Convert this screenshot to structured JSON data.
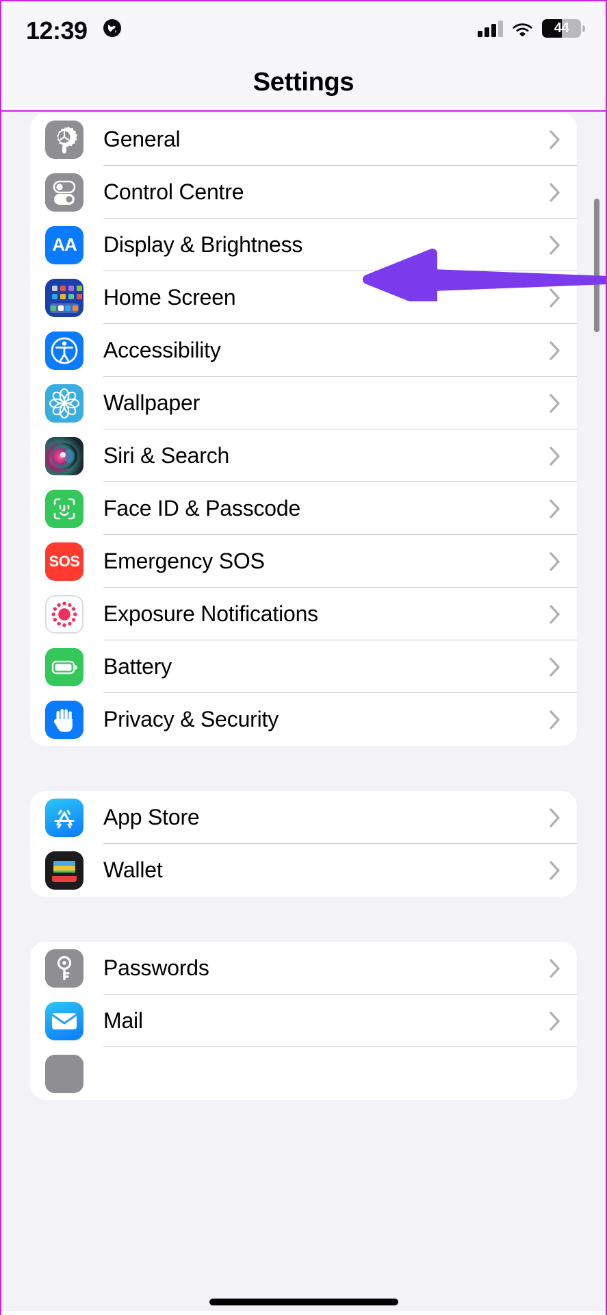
{
  "status_bar": {
    "time": "12:39",
    "location_icon": "globe-icon",
    "signal_icon": "cellular-signal-icon",
    "signal_bars_filled": 3,
    "signal_bars_total": 4,
    "wifi_icon": "wifi-icon",
    "battery_percent": "44",
    "battery_level": 44
  },
  "navbar": {
    "title": "Settings"
  },
  "groups": [
    {
      "id": "system-group",
      "rows": [
        {
          "label": "General",
          "icon": "gear-icon",
          "icon_class": "ic-gear",
          "art": "gear"
        },
        {
          "label": "Control Centre",
          "icon": "control-centre-icon",
          "icon_class": "ic-cc",
          "art": "toggles"
        },
        {
          "label": "Display & Brightness",
          "icon": "display-brightness-icon",
          "icon_class": "ic-disp",
          "art": "aa"
        },
        {
          "label": "Home Screen",
          "icon": "home-screen-icon",
          "icon_class": "ic-home",
          "art": "homegrid"
        },
        {
          "label": "Accessibility",
          "icon": "accessibility-icon",
          "icon_class": "ic-acc",
          "art": "accessibility"
        },
        {
          "label": "Wallpaper",
          "icon": "wallpaper-icon",
          "icon_class": "ic-wall",
          "art": "flower"
        },
        {
          "label": "Siri & Search",
          "icon": "siri-icon",
          "icon_class": "ic-siri",
          "art": "siri"
        },
        {
          "label": "Face ID & Passcode",
          "icon": "face-id-icon",
          "icon_class": "ic-face",
          "art": "faceid"
        },
        {
          "label": "Emergency SOS",
          "icon": "emergency-sos-icon",
          "icon_class": "ic-sos",
          "art": "sos"
        },
        {
          "label": "Exposure Notifications",
          "icon": "exposure-notifications-icon",
          "icon_class": "ic-exp",
          "art": "exposure"
        },
        {
          "label": "Battery",
          "icon": "battery-icon",
          "icon_class": "ic-batt",
          "art": "battery"
        },
        {
          "label": "Privacy & Security",
          "icon": "privacy-security-icon",
          "icon_class": "ic-priv",
          "art": "hand"
        }
      ]
    },
    {
      "id": "store-group",
      "rows": [
        {
          "label": "App Store",
          "icon": "app-store-icon",
          "icon_class": "ic-apps",
          "art": "appstore"
        },
        {
          "label": "Wallet",
          "icon": "wallet-icon",
          "icon_class": "ic-wallet",
          "art": "wallet"
        }
      ]
    },
    {
      "id": "accounts-group",
      "rows": [
        {
          "label": "Passwords",
          "icon": "passwords-key-icon",
          "icon_class": "ic-pass",
          "art": "key"
        },
        {
          "label": "Mail",
          "icon": "mail-icon",
          "icon_class": "ic-mail",
          "art": "envelope"
        },
        {
          "label": "",
          "icon": "contacts-icon",
          "icon_class": "ic-gray",
          "art": "blank"
        }
      ]
    }
  ],
  "annotation": {
    "type": "arrow",
    "direction": "left",
    "color": "#7c3aed",
    "points_at": "Display & Brightness"
  },
  "chrome": {
    "scrollbar": "vertical-scrollbar",
    "home_indicator": "home-indicator",
    "frame_border_color": "#c724e8"
  },
  "chevron_icon": "chevron-right-icon"
}
